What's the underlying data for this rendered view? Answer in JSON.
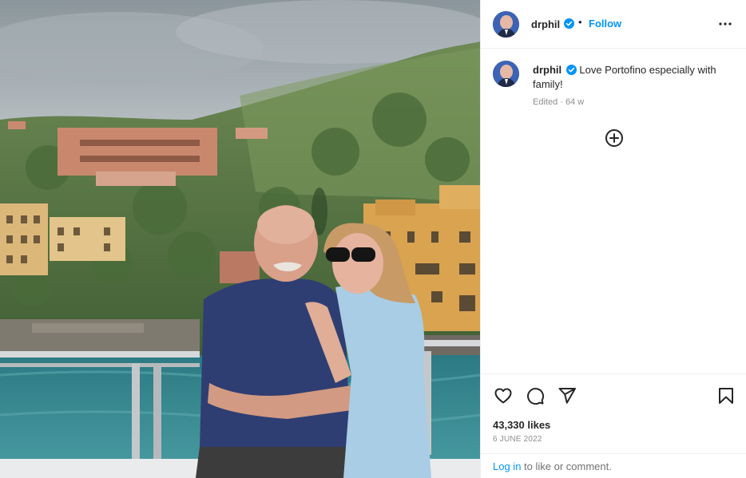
{
  "post": {
    "image_alt": "Couple posing on a boat in front of Portofino hillside"
  },
  "header": {
    "username": "drphil",
    "separator": "•",
    "follow_label": "Follow",
    "more_icon": "more-options-icon"
  },
  "caption": {
    "username": "drphil",
    "text": "Love Portofino especially with family!",
    "meta": "Edited · 64 w"
  },
  "actions": {
    "icons": [
      "heart-icon",
      "comment-icon",
      "share-icon",
      "bookmark-icon"
    ],
    "likes": "43,330 likes",
    "date": "6 JUNE 2022"
  },
  "login": {
    "link": "Log in",
    "rest": " to like or comment."
  },
  "colors": {
    "link_blue": "#0095f6",
    "verified_blue": "#0095f6",
    "text": "#262626",
    "muted": "#8e8e8e"
  }
}
